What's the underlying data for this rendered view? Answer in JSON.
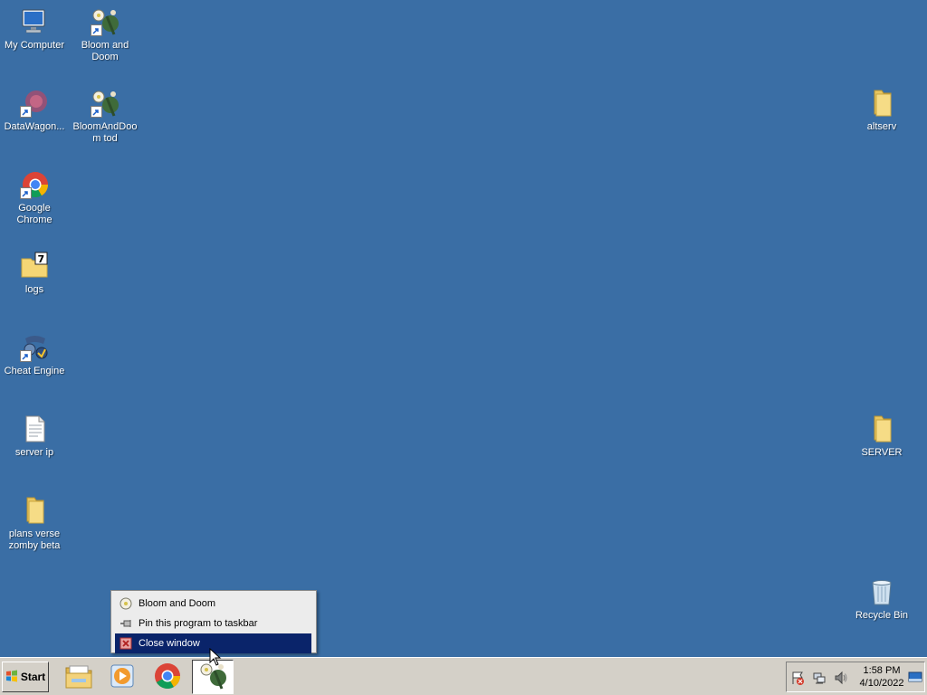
{
  "desktop": {
    "icons": [
      {
        "label": "My Computer",
        "icon": "computer-icon"
      },
      {
        "label": "Bloom and Doom",
        "icon": "bloom-and-doom-icon"
      },
      {
        "label": "DataWagon...",
        "icon": "datawagon-icon"
      },
      {
        "label": "BloomAndDoom tod",
        "icon": "bloom-and-doom-icon"
      },
      {
        "label": "Google Chrome",
        "icon": "chrome-icon"
      },
      {
        "label": "logs",
        "icon": "7zip-folder-icon"
      },
      {
        "label": "Cheat Engine",
        "icon": "cheat-engine-icon"
      },
      {
        "label": "server ip",
        "icon": "text-file-icon"
      },
      {
        "label": "plans verse zomby beta",
        "icon": "folder-icon"
      },
      {
        "label": "altserv",
        "icon": "folder-icon"
      },
      {
        "label": "SERVER",
        "icon": "folder-icon"
      },
      {
        "label": "Recycle Bin",
        "icon": "recycle-bin-icon"
      }
    ]
  },
  "context_menu": {
    "items": [
      {
        "label": "Bloom and Doom",
        "icon": "bloom-and-doom-icon"
      },
      {
        "label": "Pin this program to taskbar",
        "icon": "pin-icon"
      },
      {
        "label": "Close window",
        "icon": "close-icon",
        "highlighted": true
      }
    ]
  },
  "taskbar": {
    "start_label": "Start",
    "buttons": [
      {
        "name": "windows-explorer",
        "icon": "folder-icon"
      },
      {
        "name": "windows-media-player",
        "icon": "media-player-icon"
      },
      {
        "name": "google-chrome",
        "icon": "chrome-icon"
      },
      {
        "name": "bloom-and-doom",
        "icon": "bloom-and-doom-icon",
        "active": true
      }
    ],
    "tray": {
      "icons": [
        "action-center-flag-icon",
        "network-icon",
        "volume-icon"
      ],
      "time": "1:58 PM",
      "date": "4/10/2022"
    }
  },
  "colors": {
    "desktop": "#3a6ea5",
    "taskbar": "#d4d0c8",
    "menu_highlight": "#0a246a"
  }
}
